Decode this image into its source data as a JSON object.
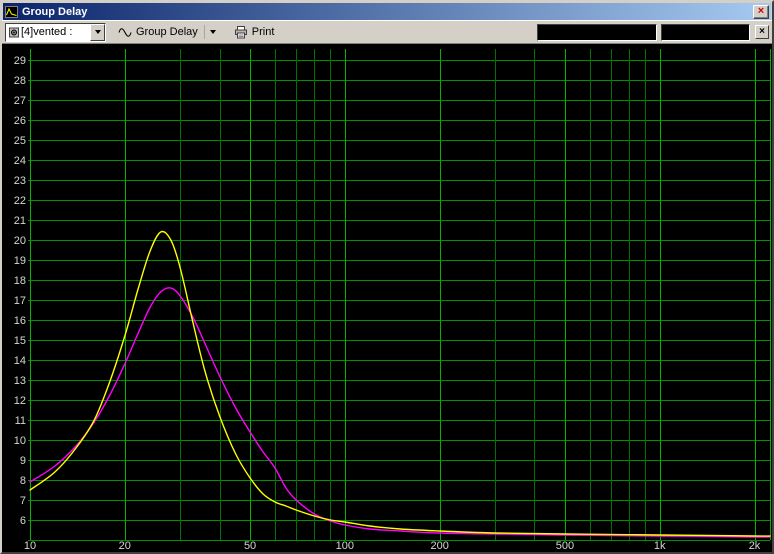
{
  "window": {
    "title": "Group Delay",
    "close_glyph": "×"
  },
  "toolbar": {
    "project_combo_value": "[4]vented :",
    "graph_type_label": "Group Delay",
    "print_label": "Print",
    "readout_left": "",
    "readout_right": "",
    "close_glyph": "×"
  },
  "colors": {
    "titlebar_left": "#0a246a",
    "titlebar_right": "#a6caf0",
    "toolbar_bg": "#d4d0c8",
    "close_x": "#cc0000",
    "plot_background": "#000000"
  },
  "chart_data": {
    "type": "line",
    "title": "Group Delay",
    "xlabel": "",
    "ylabel": "",
    "x_scale": "log",
    "xlim": [
      10,
      2240
    ],
    "ylim": [
      5,
      29.5
    ],
    "x_ticks": {
      "values": [
        10,
        20,
        50,
        100,
        200,
        500,
        1000,
        2000
      ],
      "labels": [
        "10",
        "20",
        "50",
        "100",
        "200",
        "500",
        "1k",
        "2k"
      ]
    },
    "y_ticks": [
      29,
      28,
      27,
      26,
      25,
      24,
      23,
      22,
      21,
      20,
      19,
      18,
      17,
      16,
      15,
      14,
      13,
      12,
      11,
      10,
      9,
      8,
      7,
      6
    ],
    "grid": true,
    "grid_colors": {
      "horizontal": "#009000",
      "vertical_minor": "#007000",
      "vertical_major": "#00b400"
    },
    "label_color": "#d6d6d6",
    "x": [
      10,
      12,
      14,
      16,
      18,
      20,
      22,
      24,
      26,
      28,
      30,
      33,
      36,
      40,
      45,
      50,
      55,
      60,
      65,
      70,
      80,
      90,
      100,
      120,
      150,
      200,
      300,
      500,
      1000,
      2000,
      2240
    ],
    "series": [
      {
        "name": "magenta-curve",
        "color": "#ff00ff",
        "values": [
          7.9,
          8.7,
          9.7,
          10.9,
          12.3,
          13.8,
          15.3,
          16.6,
          17.4,
          17.6,
          17.2,
          16.1,
          14.8,
          13.2,
          11.6,
          10.4,
          9.4,
          8.6,
          7.6,
          7.0,
          6.3,
          5.95,
          5.75,
          5.55,
          5.45,
          5.35,
          5.3,
          5.25,
          5.2,
          5.15,
          5.15
        ]
      },
      {
        "name": "yellow-curve",
        "color": "#ffff00",
        "values": [
          7.5,
          8.4,
          9.6,
          11.0,
          13.0,
          15.2,
          17.5,
          19.4,
          20.4,
          20.0,
          18.6,
          15.8,
          13.4,
          11.2,
          9.3,
          8.1,
          7.3,
          6.9,
          6.7,
          6.5,
          6.2,
          6.0,
          5.9,
          5.7,
          5.55,
          5.45,
          5.35,
          5.3,
          5.25,
          5.2,
          5.2
        ]
      }
    ]
  }
}
